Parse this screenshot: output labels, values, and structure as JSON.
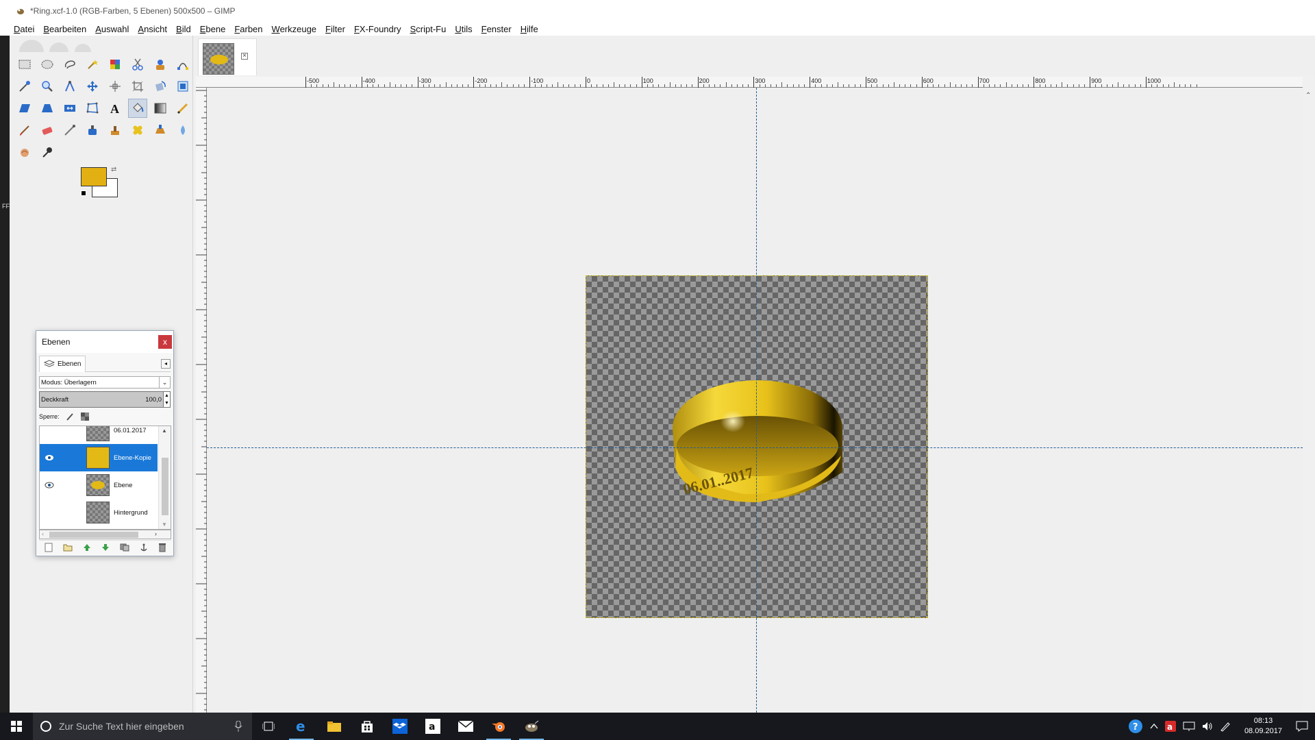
{
  "window": {
    "title": "*Ring.xcf-1.0 (RGB-Farben, 5 Ebenen) 500x500 – GIMP"
  },
  "menu": [
    "Datei",
    "Bearbeiten",
    "Auswahl",
    "Ansicht",
    "Bild",
    "Ebene",
    "Farben",
    "Werkzeuge",
    "Filter",
    "FX-Foundry",
    "Script-Fu",
    "Utils",
    "Fenster",
    "Hilfe"
  ],
  "leftstrip": {
    "label": "FF"
  },
  "colors": {
    "foreground": "#e3b014",
    "background": "#ffffff",
    "selected_layer": "#1a79d8",
    "guide": "#1f5d99",
    "ring_gold": "#e6c21a"
  },
  "tools": [
    "rect-select",
    "ellipse-select",
    "free-select",
    "fuzzy-select",
    "select-by-color",
    "scissors",
    "foreground-select",
    "paths",
    "color-picker",
    "zoom",
    "measure",
    "move",
    "align",
    "crop",
    "rotate",
    "scale",
    "shear",
    "perspective",
    "flip",
    "cage-transform",
    "text",
    "bucket-fill",
    "blend",
    "pencil",
    "paintbrush",
    "eraser",
    "airbrush",
    "ink",
    "clone",
    "heal",
    "perspective-clone",
    "blur-sharpen",
    "smudge",
    "dodge-burn"
  ],
  "layers_dialog": {
    "title": "Ebenen",
    "close": "x",
    "tab_label": "Ebenen",
    "mode": "Modus: Überlagern",
    "opacity_label": "Deckkraft",
    "opacity_value": "100,0",
    "lock_label": "Sperre:",
    "layers": [
      {
        "name": "06.01.2017",
        "visible": false,
        "selected": false
      },
      {
        "name": "Ebene-Kopie",
        "visible": true,
        "selected": true
      },
      {
        "name": "Ebene",
        "visible": true,
        "selected": false
      },
      {
        "name": "Hintergrund",
        "visible": false,
        "selected": false
      }
    ]
  },
  "image_tab": {
    "close": "×"
  },
  "ruler": {
    "h_labels": [
      "-500",
      "-400",
      "-300",
      "-200",
      "-100",
      "0",
      "100",
      "200",
      "300",
      "400",
      "500",
      "600",
      "700",
      "800",
      "900",
      "1000"
    ]
  },
  "ring": {
    "engraving": "06.01..2017"
  },
  "taskbar": {
    "search_placeholder": "Zur Suche Text hier eingeben",
    "time": "08:13",
    "date": "08.09.2017"
  }
}
